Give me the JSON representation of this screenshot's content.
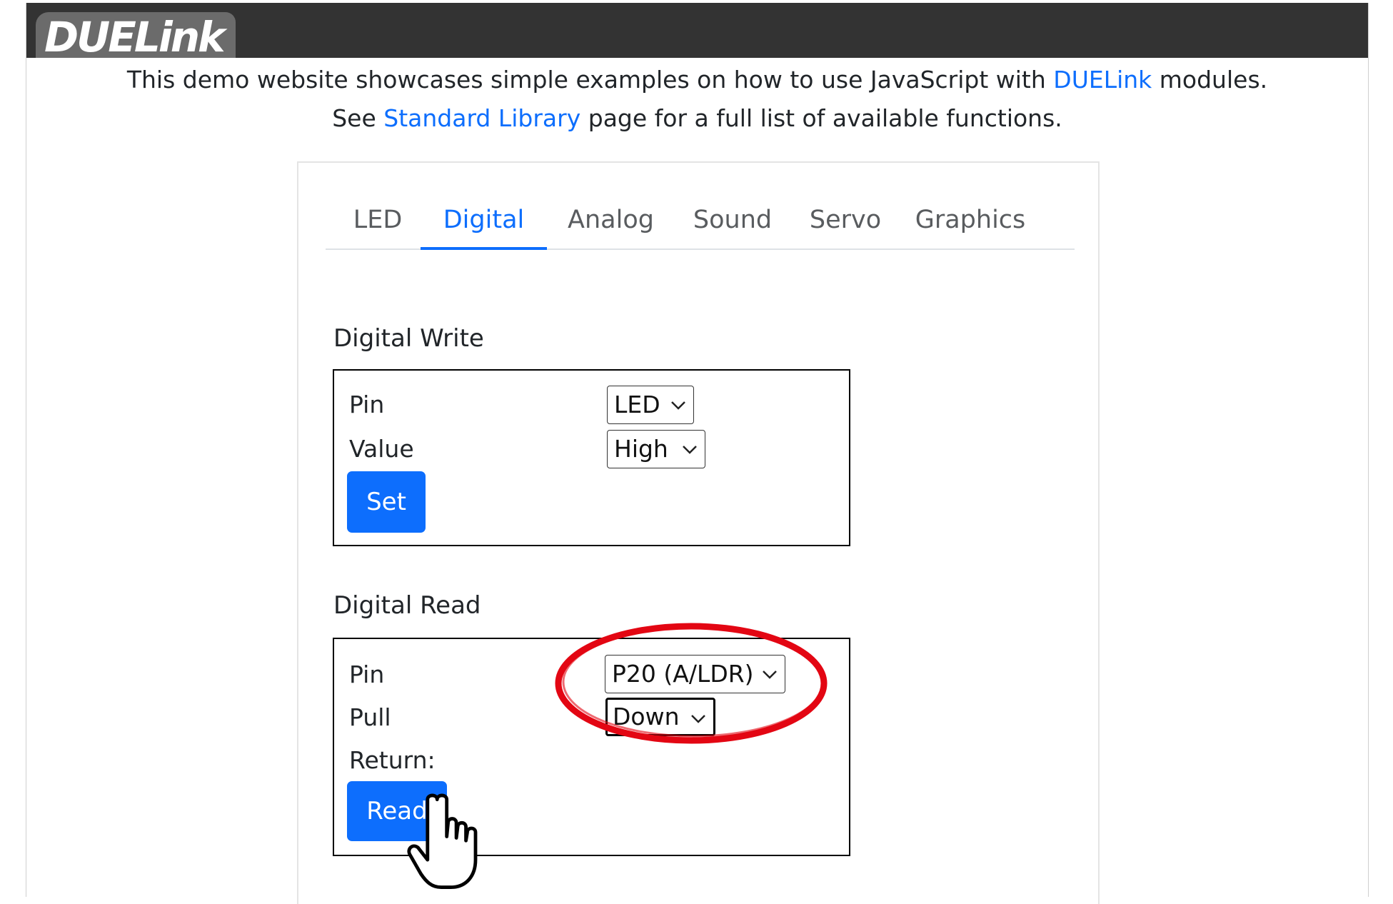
{
  "header": {
    "logo_text": "DUELink"
  },
  "intro": {
    "line1_prefix": "This demo website showcases simple examples on how to use JavaScript with ",
    "line1_link": "DUELink",
    "line1_suffix": " modules.",
    "line2_prefix": "See ",
    "line2_link": "Standard Library",
    "line2_suffix": " page for a full list of available functions."
  },
  "tabs": [
    {
      "label": "LED",
      "active": false
    },
    {
      "label": "Digital",
      "active": true
    },
    {
      "label": "Analog",
      "active": false
    },
    {
      "label": "Sound",
      "active": false
    },
    {
      "label": "Servo",
      "active": false
    },
    {
      "label": "Graphics",
      "active": false
    }
  ],
  "digital_write": {
    "title": "Digital Write",
    "pin_label": "Pin",
    "pin_value": "LED",
    "value_label": "Value",
    "value_value": "High",
    "button": "Set"
  },
  "digital_read": {
    "title": "Digital Read",
    "pin_label": "Pin",
    "pin_value": "P20 (A/LDR)",
    "pull_label": "Pull",
    "pull_value": "Down",
    "return_label": "Return:",
    "button": "Read"
  },
  "colors": {
    "accent": "#0d6efd",
    "header_bg": "#333333",
    "annotation": "#e30613"
  }
}
